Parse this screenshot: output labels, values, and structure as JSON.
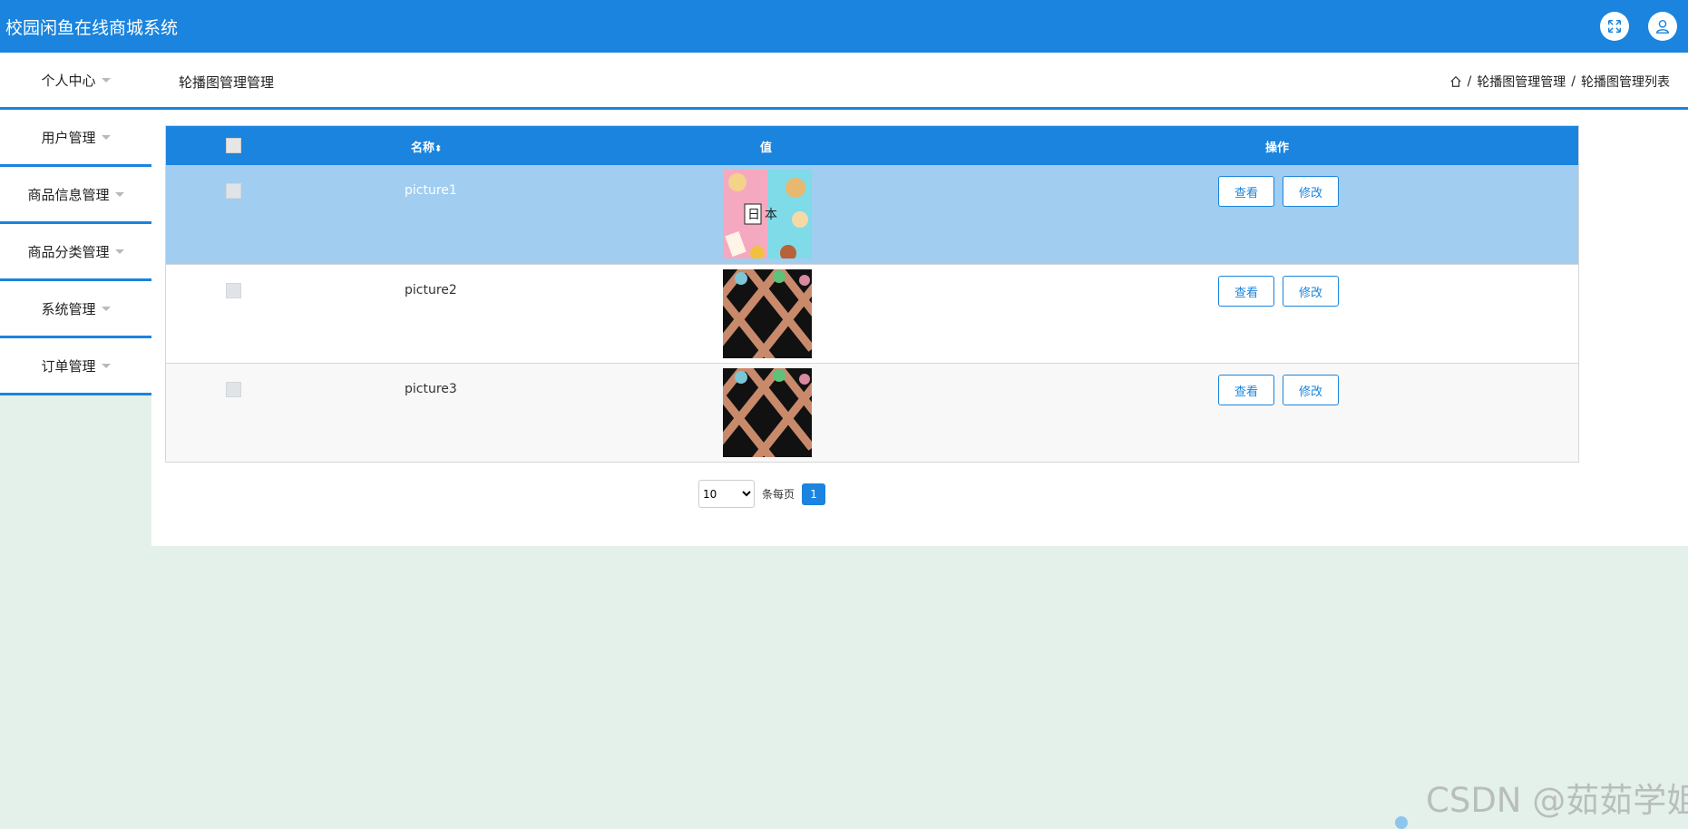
{
  "app": {
    "title": "校园闲鱼在线商城系统"
  },
  "header": {
    "fullscreen_icon": "expand-icon",
    "user_icon": "user-icon"
  },
  "sidebar": {
    "items": [
      {
        "label": "个人中心"
      },
      {
        "label": "用户管理"
      },
      {
        "label": "商品信息管理"
      },
      {
        "label": "商品分类管理"
      },
      {
        "label": "系统管理"
      },
      {
        "label": "订单管理"
      }
    ]
  },
  "page": {
    "title": "轮播图管理管理",
    "breadcrumb": [
      "轮播图管理管理",
      "轮播图管理列表"
    ],
    "separator": "/"
  },
  "table": {
    "headers": {
      "name": "名称",
      "value": "值",
      "action": "操作"
    },
    "sort_glyph": "⬍",
    "rows": [
      {
        "name": "picture1",
        "image": "japan-sweets-banner",
        "selected": true
      },
      {
        "name": "picture2",
        "image": "diagonal-stripes-banner",
        "selected": false
      },
      {
        "name": "picture3",
        "image": "diagonal-stripes-banner",
        "selected": false
      }
    ],
    "view_label": "查看",
    "edit_label": "修改"
  },
  "pagination": {
    "page_size": "10",
    "page_size_options": [
      "10"
    ],
    "per_page_label": "条每页",
    "current_page": "1"
  },
  "watermark": "CSDN @茹茹学姐",
  "colors": {
    "primary": "#1a84de",
    "selected_row": "#a1cdf0",
    "background": "#e4f0ea"
  }
}
